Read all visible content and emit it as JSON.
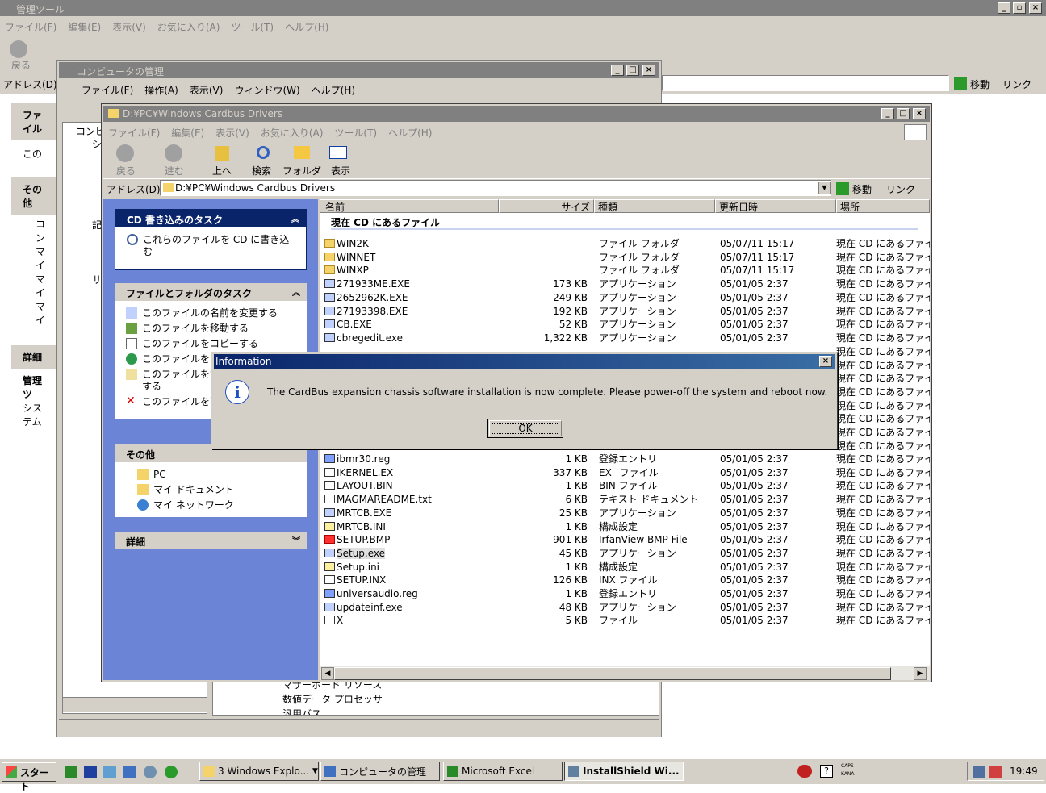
{
  "bg_window": {
    "title": "管理ツール",
    "menu": [
      "ファイル(F)",
      "編集(E)",
      "表示(V)",
      "お気に入り(A)",
      "ツール(T)",
      "ヘルプ(H)"
    ],
    "back_label": "戻る",
    "address_label": "アドレス(D)",
    "go_label": "移動",
    "links_label": "リンク",
    "side_file": "ファイル",
    "side_file_item": "この",
    "side_other": "その他",
    "side_other_items": [
      "コン",
      "マイ",
      "マイ",
      "マイ"
    ],
    "side_detail": "詳細",
    "side_detail_title": "管理ツ",
    "side_detail_sub": "システム"
  },
  "mmc": {
    "title": "コンピュータの管理",
    "menu": [
      "ファイル(F)",
      "操作(A)",
      "表示(V)",
      "ウィンドウ(W)",
      "ヘルプ(H)"
    ],
    "tree": [
      "コンピ",
      "シ",
      "記",
      "サ"
    ],
    "bottom_items": [
      "マザーボード リソース",
      "数値データ プロセッサ",
      "汎用バス"
    ]
  },
  "explorer": {
    "title": "D:¥PC¥Windows Cardbus Drivers",
    "menu": [
      "ファイル(F)",
      "編集(E)",
      "表示(V)",
      "お気に入り(A)",
      "ツール(T)",
      "ヘルプ(H)"
    ],
    "toolbar": {
      "back": "戻る",
      "forward": "進む",
      "up": "上へ",
      "search": "検索",
      "folders": "フォルダ",
      "views": "表示"
    },
    "address_label": "アドレス(D)",
    "address_value": "D:¥PC¥Windows Cardbus Drivers",
    "go_label": "移動",
    "links_label": "リンク",
    "cd_task": {
      "header": "CD 書き込みのタスク",
      "item": "これらのファイルを CD に書き込む"
    },
    "file_task": {
      "header": "ファイルとフォルダのタスク",
      "items": [
        "このファイルの名前を変更する",
        "このファイルを移動する",
        "このファイルをコピーする",
        "このファイルを W",
        "このファイルを電",
        "する",
        "このファイルを削"
      ]
    },
    "other": {
      "header": "その他",
      "items": [
        "PC",
        "マイ ドキュメント",
        "マイ ネットワーク"
      ]
    },
    "details": {
      "header": "詳細"
    },
    "columns": {
      "name": "名前",
      "size": "サイズ",
      "type": "種類",
      "date": "更新日時",
      "location": "場所"
    },
    "group_header": "現在 CD にあるファイル",
    "files_top": [
      {
        "icon": "folder",
        "name": "WIN2K",
        "size": "",
        "type": "ファイル フォルダ",
        "date": "05/07/11 15:17",
        "loc": "現在 CD にあるファイ"
      },
      {
        "icon": "folder",
        "name": "WINNET",
        "size": "",
        "type": "ファイル フォルダ",
        "date": "05/07/11 15:17",
        "loc": "現在 CD にあるファイ"
      },
      {
        "icon": "folder",
        "name": "WINXP",
        "size": "",
        "type": "ファイル フォルダ",
        "date": "05/07/11 15:17",
        "loc": "現在 CD にあるファイ"
      },
      {
        "icon": "exe",
        "name": "271933ME.EXE",
        "size": "173 KB",
        "type": "アプリケーション",
        "date": "05/01/05 2:37",
        "loc": "現在 CD にあるファイ"
      },
      {
        "icon": "exe",
        "name": "2652962K.EXE",
        "size": "249 KB",
        "type": "アプリケーション",
        "date": "05/01/05 2:37",
        "loc": "現在 CD にあるファイ"
      },
      {
        "icon": "exe",
        "name": "27193398.EXE",
        "size": "192 KB",
        "type": "アプリケーション",
        "date": "05/01/05 2:37",
        "loc": "現在 CD にあるファイ"
      },
      {
        "icon": "exe",
        "name": "CB.EXE",
        "size": "52 KB",
        "type": "アプリケーション",
        "date": "05/01/05 2:37",
        "loc": "現在 CD にあるファイ"
      },
      {
        "icon": "exe",
        "name": "cbregedit.exe",
        "size": "1,322 KB",
        "type": "アプリケーション",
        "date": "05/01/05 2:37",
        "loc": "現在 CD にあるファイ"
      }
    ],
    "loc_hidden": [
      "現在 CD にあるファイ",
      "現在 CD にあるファイ",
      "現在 CD にあるファイ",
      "現在 CD にあるファイ",
      "現在 CD にあるファイ",
      "現在 CD にあるファイ",
      "現在 CD にあるファイ",
      "現在 CD にあるファイ"
    ],
    "files_bottom": [
      {
        "icon": "reg",
        "name": "ibmr30.reg",
        "size": "1 KB",
        "type": "登録エントリ",
        "date": "05/01/05 2:37",
        "loc": "現在 CD にあるファイ"
      },
      {
        "icon": "doc",
        "name": "IKERNEL.EX_",
        "size": "337 KB",
        "type": "EX_ ファイル",
        "date": "05/01/05 2:37",
        "loc": "現在 CD にあるファイ"
      },
      {
        "icon": "doc",
        "name": "LAYOUT.BIN",
        "size": "1 KB",
        "type": "BIN ファイル",
        "date": "05/01/05 2:37",
        "loc": "現在 CD にあるファイ"
      },
      {
        "icon": "doc",
        "name": "MAGMAREADME.txt",
        "size": "6 KB",
        "type": "テキスト ドキュメント",
        "date": "05/01/05 2:37",
        "loc": "現在 CD にあるファイ"
      },
      {
        "icon": "exe",
        "name": "MRTCB.EXE",
        "size": "25 KB",
        "type": "アプリケーション",
        "date": "05/01/05 2:37",
        "loc": "現在 CD にあるファイ"
      },
      {
        "icon": "ini",
        "name": "MRTCB.INI",
        "size": "1 KB",
        "type": "構成設定",
        "date": "05/01/05 2:37",
        "loc": "現在 CD にあるファイ"
      },
      {
        "icon": "bmp",
        "name": "SETUP.BMP",
        "size": "901 KB",
        "type": "IrfanView BMP File",
        "date": "05/01/05 2:37",
        "loc": "現在 CD にあるファイ"
      },
      {
        "icon": "exe",
        "name": "Setup.exe",
        "size": "45 KB",
        "type": "アプリケーション",
        "date": "05/01/05 2:37",
        "loc": "現在 CD にあるファイ"
      },
      {
        "icon": "ini",
        "name": "Setup.ini",
        "size": "1 KB",
        "type": "構成設定",
        "date": "05/01/05 2:37",
        "loc": "現在 CD にあるファイ"
      },
      {
        "icon": "doc",
        "name": "SETUP.INX",
        "size": "126 KB",
        "type": "INX ファイル",
        "date": "05/01/05 2:37",
        "loc": "現在 CD にあるファイ"
      },
      {
        "icon": "reg",
        "name": "universaudio.reg",
        "size": "1 KB",
        "type": "登録エントリ",
        "date": "05/01/05 2:37",
        "loc": "現在 CD にあるファイ"
      },
      {
        "icon": "exe",
        "name": "updateinf.exe",
        "size": "48 KB",
        "type": "アプリケーション",
        "date": "05/01/05 2:37",
        "loc": "現在 CD にあるファイ"
      },
      {
        "icon": "doc",
        "name": "X",
        "size": "5 KB",
        "type": "ファイル",
        "date": "05/01/05 2:37",
        "loc": "現在 CD にあるファイ"
      }
    ]
  },
  "dialog": {
    "title": "Information",
    "message": "The CardBus expansion chassis software installation is now complete.  Please power-off the system and reboot now.",
    "ok": "OK"
  },
  "taskbar": {
    "start": "スタート",
    "buttons": [
      "3 Windows Explo...",
      "コンピュータの管理",
      "Microsoft Excel",
      "InstallShield Wi..."
    ],
    "clock": "19:49",
    "caps": "CAPS",
    "kana": "KANA"
  },
  "colors": {
    "title_active": "#0a246a",
    "title_inactive": "#808080",
    "face": "#d4d0c8",
    "panel_bg": "#6b84d6"
  }
}
